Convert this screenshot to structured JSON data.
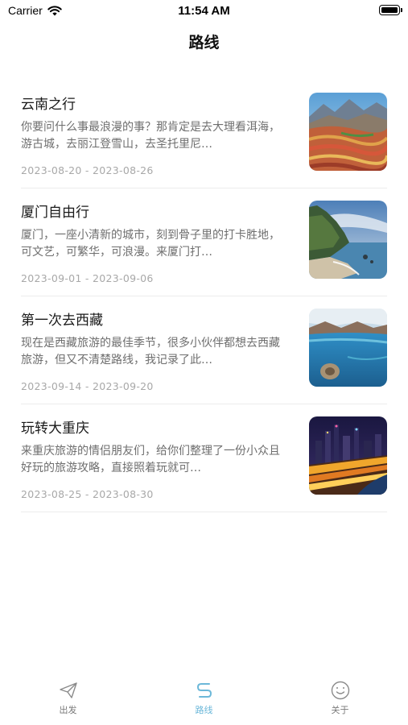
{
  "status_bar": {
    "carrier": "Carrier",
    "time": "11:54 AM"
  },
  "nav": {
    "title": "路线"
  },
  "routes": [
    {
      "title": "云南之行",
      "desc": "你要问什么事最浪漫的事？那肯定是去大理看洱海，游古城，去丽江登雪山，去圣托里尼…",
      "date": "2023-08-20 - 2023-08-26",
      "image": "mountain-terraces-photo"
    },
    {
      "title": "厦门自由行",
      "desc": "厦门，一座小清新的城市，刻到骨子里的打卡胜地，可文艺，可繁华，可浪漫。来厦门打…",
      "date": "2023-09-01 - 2023-09-06",
      "image": "coastline-photo"
    },
    {
      "title": "第一次去西藏",
      "desc": "现在是西藏旅游的最佳季节，很多小伙伴都想去西藏旅游，但又不清楚路线，我记录了此…",
      "date": "2023-09-14 - 2023-09-20",
      "image": "blue-lake-photo"
    },
    {
      "title": "玩转大重庆",
      "desc": "来重庆旅游的情侣朋友们，给你们整理了一份小众且好玩的旅游攻略，直接照着玩就可…",
      "date": "2023-08-25 - 2023-08-30",
      "image": "city-night-photo"
    }
  ],
  "tab_bar": {
    "tabs": [
      {
        "label": "出发",
        "icon": "paper-plane-icon",
        "active": false
      },
      {
        "label": "路线",
        "icon": "route-icon",
        "active": true
      },
      {
        "label": "关于",
        "icon": "smile-icon",
        "active": false
      }
    ],
    "active_color": "#6cb8d9",
    "inactive_color": "#7a7a7a"
  }
}
